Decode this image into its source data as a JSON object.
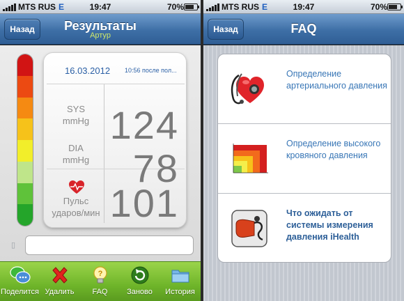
{
  "status": {
    "carrier": "MTS RUS",
    "network": "E",
    "time": "19:47",
    "battery": "70%"
  },
  "results_screen": {
    "back_label": "Назад",
    "title": "Результаты",
    "user_name": "Артур",
    "date": "16.03.2012",
    "time": "10:56 после пол...",
    "sys_label": "SYS\nmmHg",
    "sys_value": "124",
    "dia_label": "DIA\nmmHg",
    "dia_value": "78",
    "pulse_label": "Пульс\nударов/мин",
    "pulse_value": "101",
    "toolbar": [
      {
        "label": "Поделится",
        "icon": "share-chat-icon"
      },
      {
        "label": "Удалить",
        "icon": "delete-x-icon"
      },
      {
        "label": "FAQ",
        "icon": "lightbulb-icon"
      },
      {
        "label": "Заново",
        "icon": "refresh-icon"
      },
      {
        "label": "История",
        "icon": "folder-icon"
      }
    ],
    "scale_colors": [
      "#d11414",
      "#ec4a12",
      "#f58a12",
      "#f6c21a",
      "#f2ee2a",
      "#bfe58a",
      "#5fc23a",
      "#24a52a"
    ]
  },
  "faq_screen": {
    "back_label": "Назад",
    "title": "FAQ",
    "items": [
      {
        "text": "Определение артериального давления",
        "icon": "heart-stethoscope-icon"
      },
      {
        "text": "Определение высокого кровяного давления",
        "icon": "bp-chart-icon"
      },
      {
        "text": "Что ожидать от системы измерения давления iHealth",
        "icon": "bp-cuff-icon"
      }
    ]
  }
}
